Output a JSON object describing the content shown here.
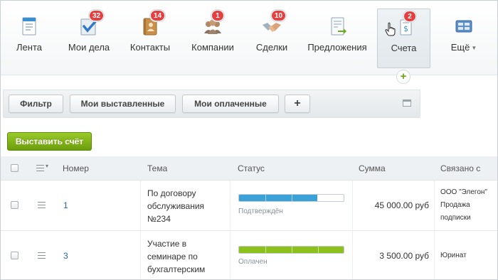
{
  "nav": {
    "items": [
      {
        "label": "Лента",
        "icon": "feed-icon"
      },
      {
        "label": "Мои дела",
        "icon": "tasks-icon",
        "badge": "32"
      },
      {
        "label": "Контакты",
        "icon": "contacts-icon",
        "badge": "14"
      },
      {
        "label": "Компании",
        "icon": "companies-icon",
        "badge": "1"
      },
      {
        "label": "Сделки",
        "icon": "deals-icon",
        "badge": "10"
      },
      {
        "label": "Предложения",
        "icon": "quotes-icon"
      },
      {
        "label": "Счета",
        "icon": "invoices-icon",
        "badge": "2",
        "active": true
      },
      {
        "label": "Ещё",
        "icon": "more-icon"
      }
    ],
    "add_symbol": "+"
  },
  "filter": {
    "filter_label": "Фильтр",
    "issued_label": "Мои выставленные",
    "paid_label": "Мои оплаченные",
    "add_label": "+"
  },
  "actions": {
    "issue_invoice_label": "Выставить счёт"
  },
  "table": {
    "columns": {
      "number": "Номер",
      "topic": "Тема",
      "status": "Статус",
      "sum": "Сумма",
      "linked": "Связано с"
    },
    "rows": [
      {
        "number": "1",
        "topic": "По договору обслуживания №234",
        "status": "Подтверждён",
        "progress": 0.75,
        "status_color": "#3aa1d9",
        "sum": "45 000.00 руб",
        "linked_company": "ООО \"Элегон\"",
        "linked_deal": "Продажа подписки"
      },
      {
        "number": "3",
        "topic": "Участие в семинаре по бухгалтерским остаткам",
        "status": "Оплачен",
        "progress": 1.0,
        "status_color": "#8cc11b",
        "sum": "3 500.00 руб",
        "linked_company": "Юринат",
        "linked_deal": ""
      }
    ]
  },
  "colors": {
    "accent_green": "#7bb31a",
    "badge_red": "#e53f3f",
    "link_blue": "#2067b0"
  }
}
